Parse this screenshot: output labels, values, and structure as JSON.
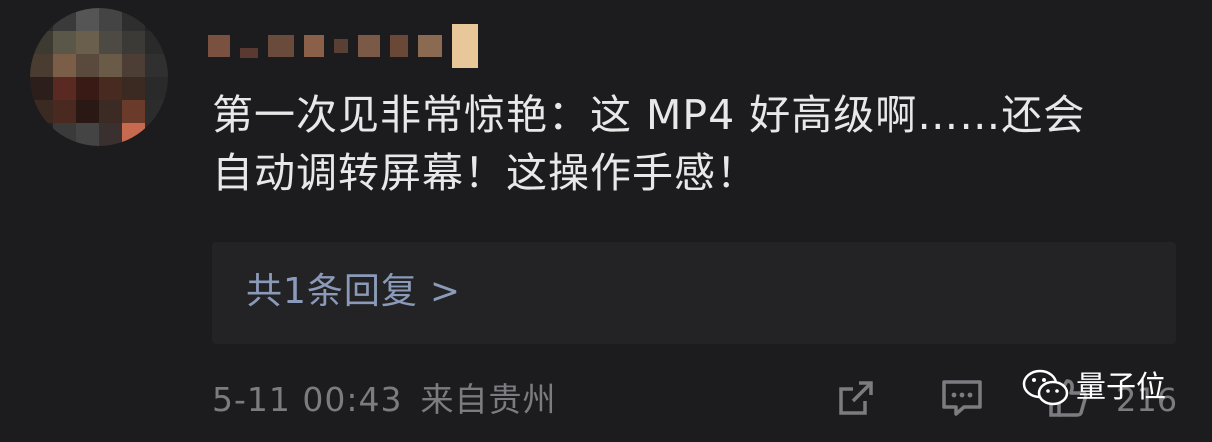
{
  "comment": {
    "text_line1": "第一次见非常惊艳：这 MP4 好高级啊……还会",
    "text_line2": "自动调转屏幕！这操作手感！"
  },
  "replies": {
    "label": "共1条回复",
    "chevron": ">"
  },
  "meta": {
    "time": "5-11 00:43",
    "location": "来自贵州"
  },
  "actions": {
    "share_icon": "share-icon",
    "comment_icon": "comment-icon",
    "like_icon": "like-icon",
    "like_count": "216"
  },
  "watermark": {
    "text": "量子位",
    "icon": "wechat-icon"
  },
  "colors": {
    "background": "#1c1c1e",
    "reply_box": "#232325",
    "reply_link": "#8a9ab8",
    "meta_text": "#7c7c80",
    "comment_text": "#e8e8e8"
  }
}
